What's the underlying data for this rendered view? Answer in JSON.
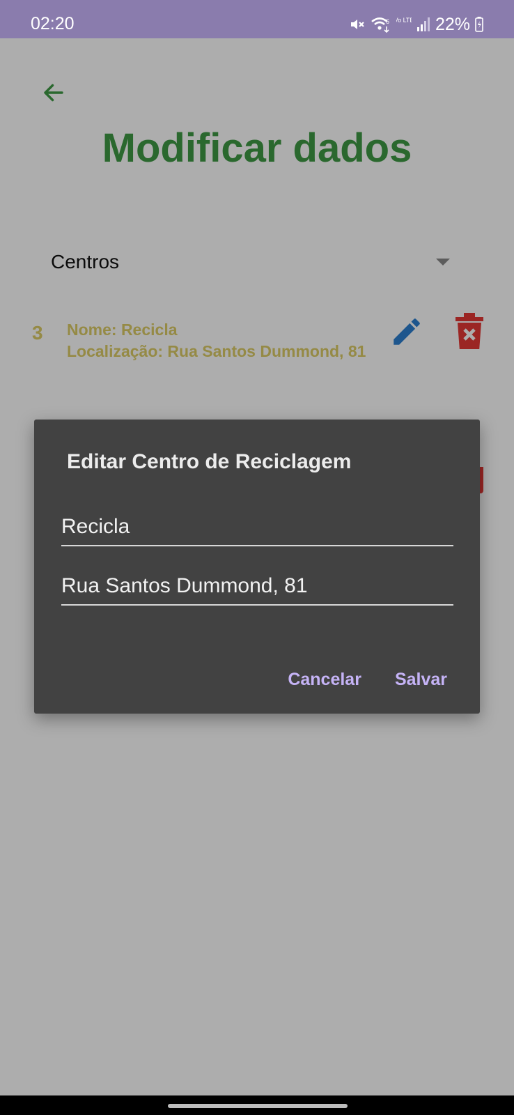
{
  "status_bar": {
    "time": "02:20",
    "wifi_label": "6",
    "volte_label": "Vo LTE",
    "battery": "22%",
    "icons": [
      "mute-icon",
      "wifi-icon",
      "volte-icon",
      "signal-icon",
      "battery-icon"
    ]
  },
  "header": {
    "title": "Modificar dados",
    "back_icon": "arrow-left-icon"
  },
  "category_select": {
    "selected": "Centros"
  },
  "list": {
    "items": [
      {
        "id": "3",
        "name": "Nome: Recicla",
        "location": "Localização: Rua Santos Dummond, 81"
      }
    ]
  },
  "dialog": {
    "title": "Editar Centro de Reciclagem",
    "name_value": "Recicla",
    "location_value": "Rua Santos Dummond, 81",
    "cancel_label": "Cancelar",
    "save_label": "Salvar"
  },
  "colors": {
    "title_green": "#3f9a44",
    "item_text": "#dccc66",
    "edit_blue": "#2d7fd0",
    "delete_red": "#e53935",
    "dialog_bg": "#424242",
    "dialog_action": "#c5b3f6",
    "status_bar": "#8a7cad"
  }
}
